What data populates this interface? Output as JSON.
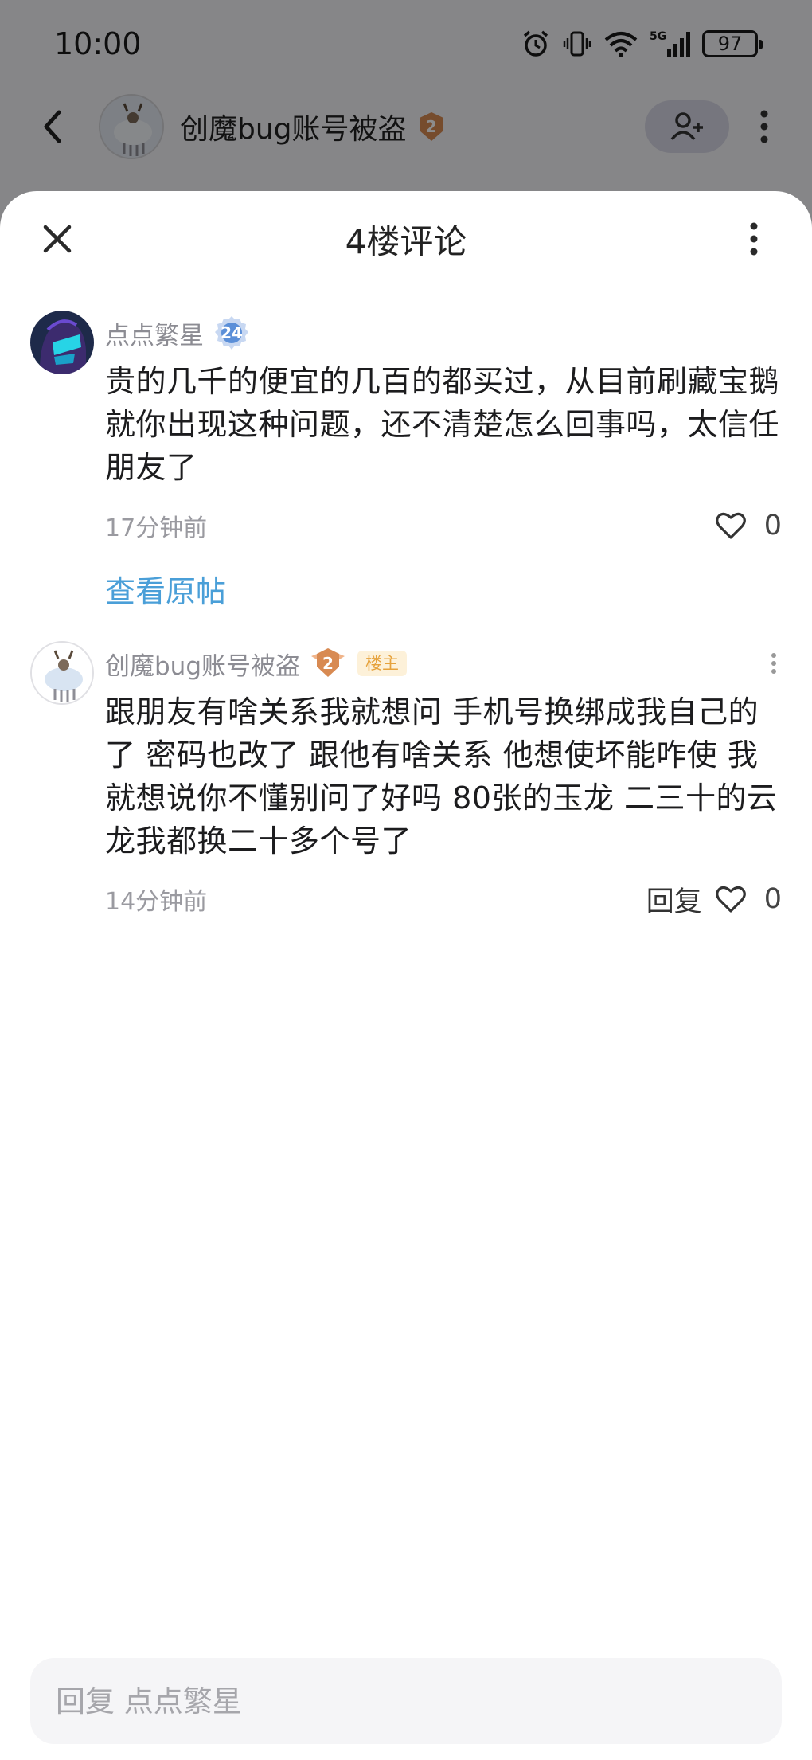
{
  "status_bar": {
    "time": "10:00",
    "network": "5G",
    "battery": "97"
  },
  "post_header": {
    "title": "创魔bug账号被盗",
    "level": "2"
  },
  "sheet": {
    "title": "4楼评论"
  },
  "comments": [
    {
      "author": "点点繁星",
      "level": "24",
      "body": "贵的几千的便宜的几百的都买过，从目前刷藏宝鹅就你出现这种问题，还不清楚怎么回事吗，太信任朋友了",
      "time": "17分钟前",
      "likes": "0",
      "link": "查看原帖"
    },
    {
      "author": "创魔bug账号被盗",
      "level": "2",
      "tag": "楼主",
      "body": "跟朋友有啥关系我就想问 手机号换绑成我自己的了 密码也改了 跟他有啥关系 他想使坏能咋使 我就想说你不懂别问了好吗 80张的玉龙 二三十的云龙我都换二十多个号了",
      "time": "14分钟前",
      "reply": "回复",
      "likes": "0"
    }
  ],
  "reply_input": {
    "placeholder": "回复 点点繁星"
  },
  "colors": {
    "link": "#4a9fd8",
    "owner_tag_bg": "#fdf1d9",
    "owner_tag_text": "#e6a23c",
    "badge_blue": "#5b8fd8",
    "badge_bronze": "#d88a52"
  },
  "icons": [
    "back-arrow-icon",
    "add-friend-icon",
    "more-vertical-icon",
    "close-icon",
    "heart-icon",
    "alarm-icon",
    "vibrate-icon",
    "wifi-icon",
    "signal-icon",
    "battery-icon"
  ]
}
